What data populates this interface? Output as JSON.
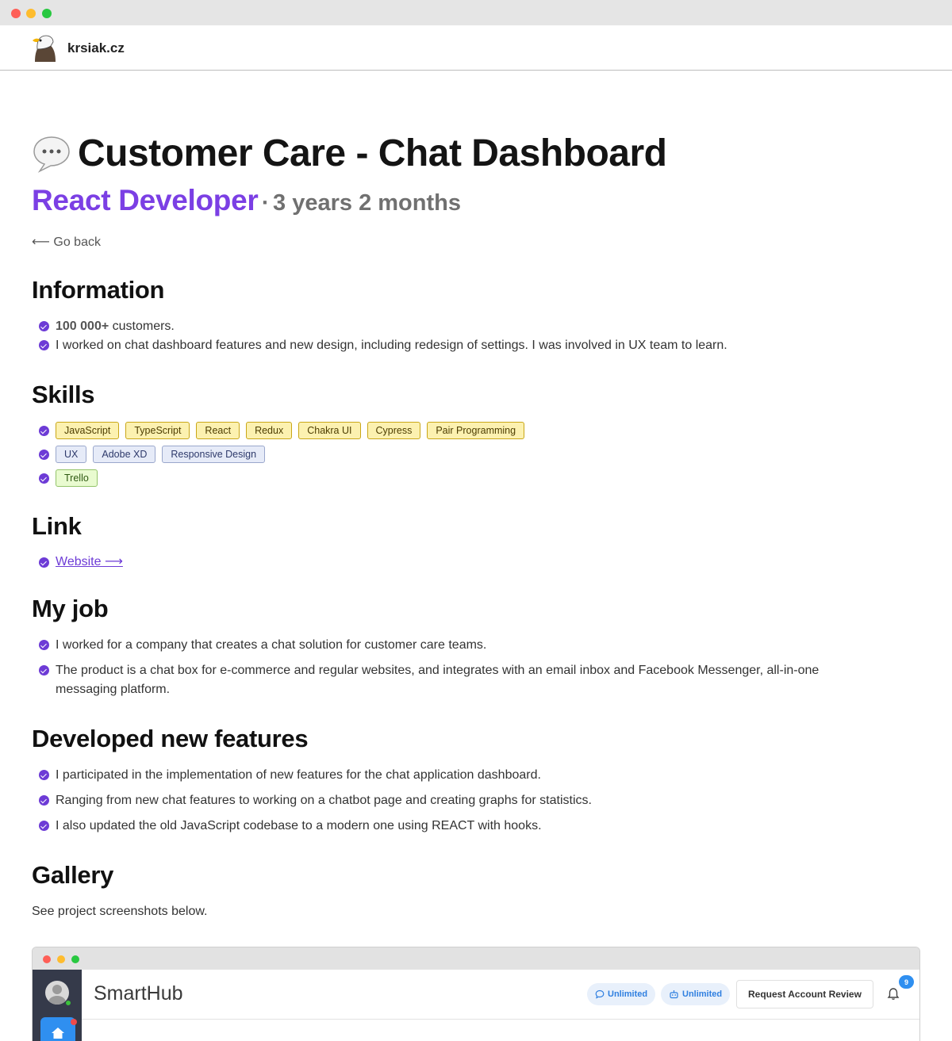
{
  "browser": {
    "window_controls": [
      "close",
      "minimize",
      "maximize"
    ]
  },
  "site": {
    "logo_icon": "eagle-icon",
    "name": "krsiak.cz"
  },
  "project": {
    "title_icon": "speech-bubble-icon",
    "title": "Customer Care - Chat Dashboard",
    "role": "React Developer",
    "separator": "·",
    "duration": "3 years 2 months",
    "go_back": "⟵ Go back"
  },
  "information": {
    "heading": "Information",
    "items": [
      {
        "strong": "100 000+",
        "text": " customers."
      },
      {
        "text": "I worked on chat dashboard features and new design, including redesign of settings. I was involved in UX team to learn."
      }
    ]
  },
  "skills": {
    "heading": "Skills",
    "groups": [
      {
        "color": "yellow",
        "tags": [
          "JavaScript",
          "TypeScript",
          "React",
          "Redux",
          "Chakra UI",
          "Cypress",
          "Pair Programming"
        ]
      },
      {
        "color": "blue",
        "tags": [
          "UX",
          "Adobe XD",
          "Responsive Design"
        ]
      },
      {
        "color": "green",
        "tags": [
          "Trello"
        ]
      }
    ]
  },
  "link": {
    "heading": "Link",
    "label": "Website ⟶"
  },
  "my_job": {
    "heading": "My job",
    "items": [
      "I worked for a company that creates a chat solution for customer care teams.",
      "The product is a chat box for e-commerce and regular websites, and integrates with an email inbox and Facebook Messenger, all-in-one",
      "messaging platform."
    ]
  },
  "features": {
    "heading": "Developed new features",
    "items": [
      "I participated in the implementation of new features for the chat application dashboard.",
      "Ranging from new chat features to working on a chatbot page and creating graphs for statistics.",
      "I also updated the old JavaScript codebase to a modern one using REACT with hooks."
    ]
  },
  "gallery": {
    "heading": "Gallery",
    "intro": "See project screenshots below.",
    "screenshot": {
      "brand": "SmartHub",
      "pill_1": "Unlimited",
      "pill_2": "Unlimited",
      "review_button": "Request Account Review",
      "notification_count": "9"
    }
  },
  "colors": {
    "accent": "#7b3fe4",
    "bullet": "#6d3bd6",
    "tag_yellow": "#fcf1b0",
    "tag_blue": "#e6ebf8",
    "tag_green": "#e9fbd0"
  }
}
